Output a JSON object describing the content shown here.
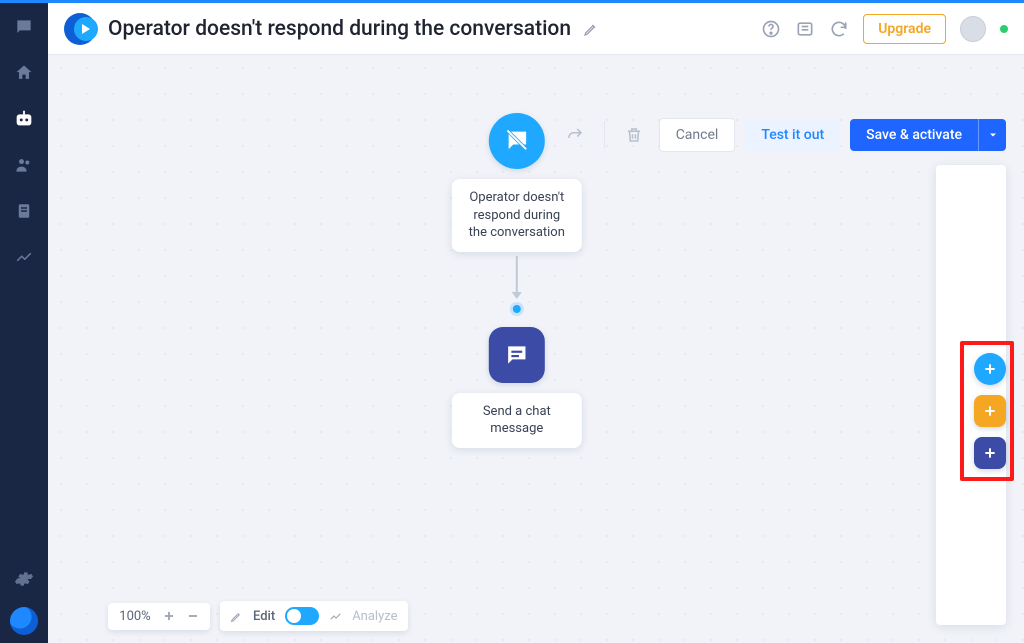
{
  "header": {
    "title": "Operator doesn't respond during the conversation",
    "upgrade_label": "Upgrade"
  },
  "toolbar": {
    "cancel_label": "Cancel",
    "test_label": "Test it out",
    "save_label": "Save & activate"
  },
  "flow": {
    "trigger": {
      "label": "Operator doesn't respond during the conversation"
    },
    "action1": {
      "label": "Send a chat message"
    }
  },
  "palette": {
    "add_trigger": "+",
    "add_condition": "+",
    "add_action": "+"
  },
  "bottom": {
    "zoom": "100%",
    "edit_label": "Edit",
    "analyze_label": "Analyze"
  }
}
